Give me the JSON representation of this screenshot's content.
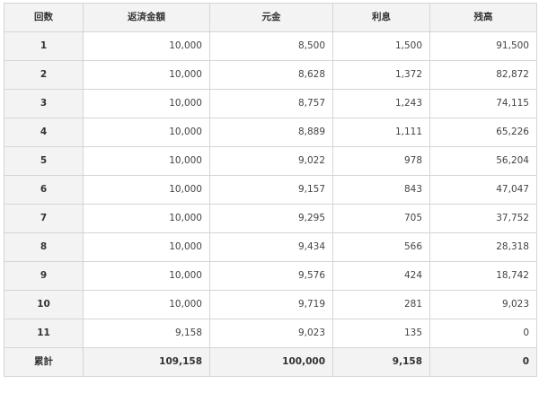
{
  "table": {
    "headers": [
      "回数",
      "返済金額",
      "元金",
      "利息",
      "残高"
    ],
    "rows": [
      [
        "1",
        "10,000",
        "8,500",
        "1,500",
        "91,500"
      ],
      [
        "2",
        "10,000",
        "8,628",
        "1,372",
        "82,872"
      ],
      [
        "3",
        "10,000",
        "8,757",
        "1,243",
        "74,115"
      ],
      [
        "4",
        "10,000",
        "8,889",
        "1,111",
        "65,226"
      ],
      [
        "5",
        "10,000",
        "9,022",
        "978",
        "56,204"
      ],
      [
        "6",
        "10,000",
        "9,157",
        "843",
        "47,047"
      ],
      [
        "7",
        "10,000",
        "9,295",
        "705",
        "37,752"
      ],
      [
        "8",
        "10,000",
        "9,434",
        "566",
        "28,318"
      ],
      [
        "9",
        "10,000",
        "9,576",
        "424",
        "18,742"
      ],
      [
        "10",
        "10,000",
        "9,719",
        "281",
        "9,023"
      ],
      [
        "11",
        "9,158",
        "9,023",
        "135",
        "0"
      ]
    ],
    "total": [
      "累計",
      "109,158",
      "100,000",
      "9,158",
      "0"
    ]
  }
}
